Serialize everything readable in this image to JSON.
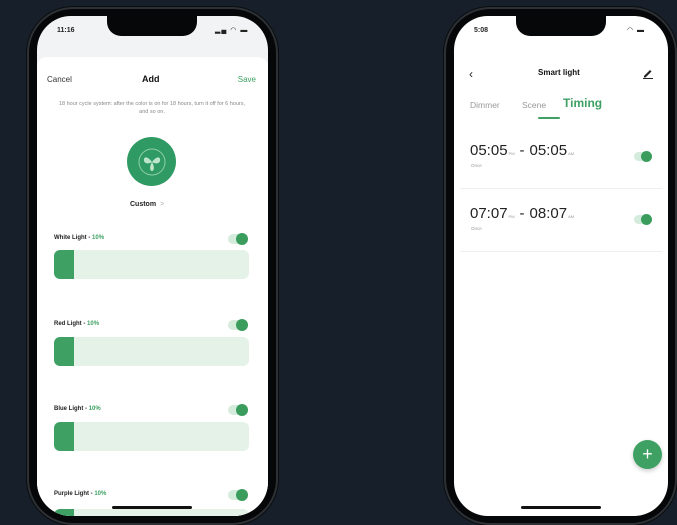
{
  "left_phone": {
    "status_time": "11:16",
    "nav": {
      "cancel": "Cancel",
      "title": "Add",
      "save": "Save"
    },
    "hint": "18 hour cycle system: after the color is on for 18 hours, turn it off for 6 hours, and so on.",
    "mode": "Custom",
    "lights": [
      {
        "label": "White Light",
        "percent": "10%",
        "enabled": true,
        "level": 0.1
      },
      {
        "label": "Red Light",
        "percent": "10%",
        "enabled": true,
        "level": 0.1
      },
      {
        "label": "Blue Light",
        "percent": "10%",
        "enabled": true,
        "level": 0.1
      },
      {
        "label": "Purple Light",
        "percent": "10%",
        "enabled": true,
        "level": 0.1
      }
    ],
    "accent": "#3ea063"
  },
  "right_phone": {
    "status_time": "5:08",
    "title": "Smart light",
    "tabs": [
      "Dimmer",
      "Scene",
      "Timing"
    ],
    "active_tab": "Timing",
    "timers": [
      {
        "start": "05:05",
        "start_ampm": "PM",
        "end": "05:05",
        "end_ampm": "AM",
        "repeat": "Once",
        "enabled": true
      },
      {
        "start": "07:07",
        "start_ampm": "PM",
        "end": "08:07",
        "end_ampm": "AM",
        "repeat": "Once",
        "enabled": true
      }
    ],
    "add_label": "+"
  }
}
